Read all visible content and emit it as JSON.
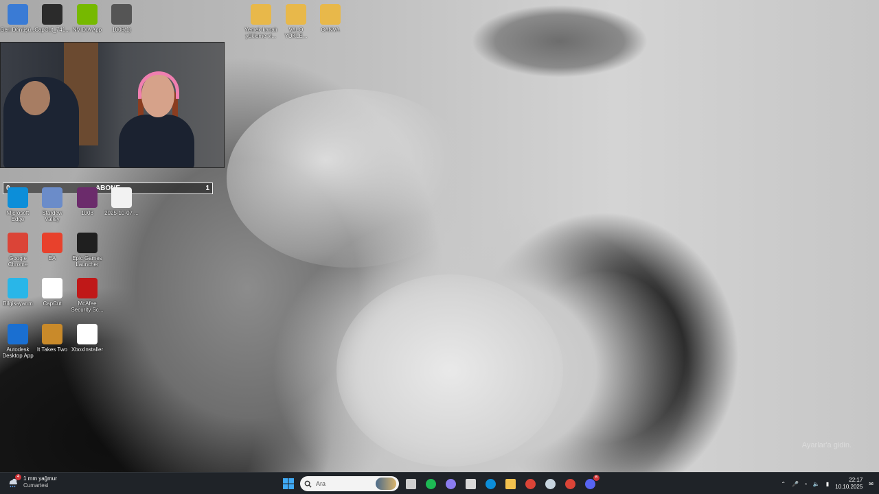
{
  "desktop": {
    "icons_row1_left": [
      {
        "label": "Geri Dönüşü...",
        "icon": "recycle-bin-icon",
        "color": "#3a7bd5"
      },
      {
        "label": "CapCut_741...",
        "icon": "capcut-setup-icon",
        "color": "#2b2b2b"
      },
      {
        "label": "NVIDIA App",
        "icon": "nvidia-icon",
        "color": "#76b900"
      },
      {
        "label": "1008(1)",
        "icon": "video-file-icon",
        "color": "#555555"
      }
    ],
    "icons_row1_right": [
      {
        "label": "Yemek kanalı yükleme vi...",
        "icon": "folder-icon",
        "color": "#e8b84a"
      },
      {
        "label": "VALO YÜKLE...",
        "icon": "folder-icon",
        "color": "#e8b84a"
      },
      {
        "label": "CANVA",
        "icon": "folder-icon",
        "color": "#e8b84a"
      }
    ],
    "icons_grid": [
      {
        "label": "Microsoft Edge",
        "icon": "edge-icon",
        "color": "#0c8ed9"
      },
      {
        "label": "Stardew Valley",
        "icon": "stardew-valley-icon",
        "color": "#6b8cc9"
      },
      {
        "label": "1008",
        "icon": "video-file-icon",
        "color": "#6b2b6b"
      },
      {
        "label": "2025-10-07 ...",
        "icon": "media-player-icon",
        "color": "#f2f2f2"
      },
      {
        "label": "Google Chrome",
        "icon": "chrome-icon",
        "color": "#db4437"
      },
      {
        "label": "EA",
        "icon": "ea-icon",
        "color": "#e8412c"
      },
      {
        "label": "Epic Games Launcher",
        "icon": "epic-games-icon",
        "color": "#1f1f1f"
      },
      {
        "label": "Bilgisayarım",
        "icon": "this-pc-icon",
        "color": "#29b6e8"
      },
      {
        "label": "CapCut",
        "icon": "capcut-icon",
        "color": "#ffffff"
      },
      {
        "label": "McAfee Security Sc...",
        "icon": "mcafee-icon",
        "color": "#c01818"
      },
      {
        "label": "Autodesk Desktop App",
        "icon": "autodesk-icon",
        "color": "#1a6fd1"
      },
      {
        "label": "It Takes Two",
        "icon": "it-takes-two-icon",
        "color": "#c98a2a"
      },
      {
        "label": "XboxInstaller",
        "icon": "xbox-icon",
        "color": "#ffffff"
      }
    ]
  },
  "subscriber_bar": {
    "left": "0",
    "title": "ABONE",
    "right": "1"
  },
  "wallpaper_watermark": "Ayarlar'a gidin.",
  "taskbar": {
    "weather": {
      "line1": "1 mm yağmur",
      "line2": "Cumartesi",
      "badge": "4"
    },
    "search_placeholder": "Ara",
    "apps": [
      {
        "name": "start-button",
        "icon": "windows-icon",
        "color": "#0078d4"
      },
      {
        "name": "task-view",
        "icon": "task-view-icon",
        "color": "#cfcfcf"
      },
      {
        "name": "spotify",
        "icon": "spotify-icon",
        "color": "#1db954"
      },
      {
        "name": "copilot",
        "icon": "copilot-icon",
        "color": "#8a7cf0"
      },
      {
        "name": "store",
        "icon": "store-icon",
        "color": "#d9d9d9"
      },
      {
        "name": "edge",
        "icon": "edge-icon",
        "color": "#0c8ed9"
      },
      {
        "name": "file-explorer",
        "icon": "folder-icon",
        "color": "#f2c14e"
      },
      {
        "name": "chrome",
        "icon": "chrome-icon",
        "color": "#db4437"
      },
      {
        "name": "steam",
        "icon": "steam-icon",
        "color": "#c7d5e0"
      },
      {
        "name": "chrome-profile",
        "icon": "chrome-icon",
        "color": "#db4437"
      },
      {
        "name": "discord",
        "icon": "discord-icon",
        "color": "#5865f2",
        "badge": "6"
      }
    ],
    "clock": {
      "time": "22:17",
      "date": "10.10.2025"
    }
  }
}
